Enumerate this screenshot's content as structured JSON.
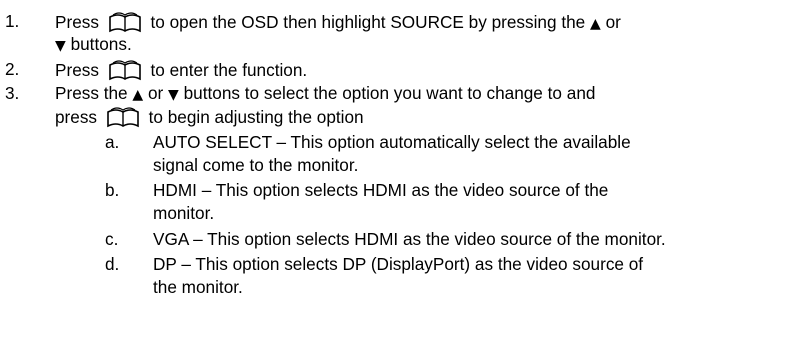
{
  "steps": [
    {
      "number": "1.",
      "line1_before": "Press",
      "line1_after": "to open the OSD then highlight SOURCE by pressing the",
      "up_arrow": "▲",
      "or_word": "or",
      "down_arrow": "▼",
      "line2_after": "buttons."
    },
    {
      "number": "2.",
      "line1_before": "Press",
      "line1_after": "to enter the function."
    },
    {
      "number": "3.",
      "line1_before": "Press the",
      "up_arrow": "▲",
      "or_word": "or",
      "down_arrow": "▼",
      "line1_after": "buttons to select the option you want to change to and",
      "line2_before": "press",
      "line2_after": "to begin adjusting the option"
    }
  ],
  "options": [
    {
      "letter": "a.",
      "line1": "AUTO SELECT – This option automatically select the available",
      "line2": "signal come to the monitor."
    },
    {
      "letter": "b.",
      "line1": "HDMI – This option selects HDMI as the video source of the",
      "line2": "monitor."
    },
    {
      "letter": "c.",
      "line1": "VGA – This option selects HDMI as the video source of the monitor."
    },
    {
      "letter": "d.",
      "line1": "DP – This option selects DP (DisplayPort) as the video source of",
      "line2": "the monitor."
    }
  ],
  "icon_name": "menu-book-icon"
}
